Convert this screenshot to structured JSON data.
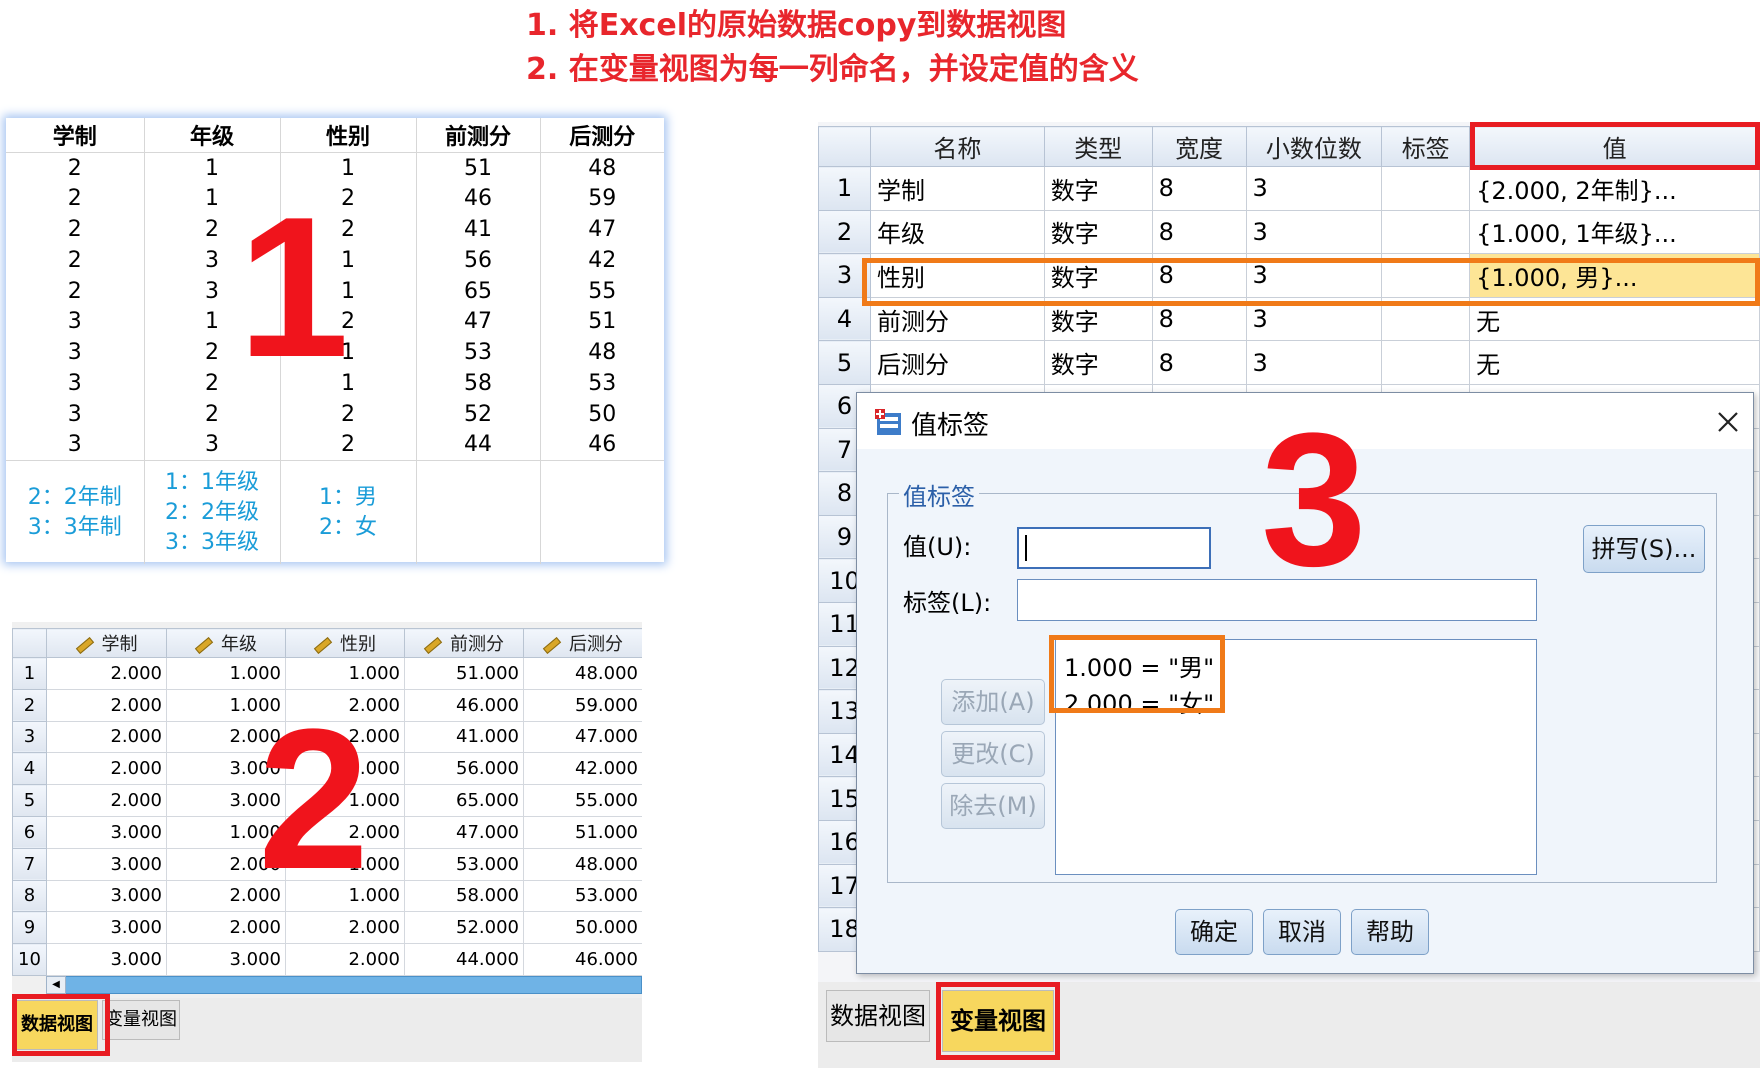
{
  "heading": {
    "line1": "1. 将Excel的原始数据copy到数据视图",
    "line2": "2. 在变量视图为每一列命名，并设定值的含义"
  },
  "panel1": {
    "big_number": "1",
    "headers": [
      "学制",
      "年级",
      "性别",
      "前测分",
      "后测分"
    ],
    "rows": [
      [
        "2",
        "1",
        "1",
        "51",
        "48"
      ],
      [
        "2",
        "1",
        "2",
        "46",
        "59"
      ],
      [
        "2",
        "2",
        "2",
        "41",
        "47"
      ],
      [
        "2",
        "3",
        "1",
        "56",
        "42"
      ],
      [
        "2",
        "3",
        "1",
        "65",
        "55"
      ],
      [
        "3",
        "1",
        "2",
        "47",
        "51"
      ],
      [
        "3",
        "2",
        "1",
        "53",
        "48"
      ],
      [
        "3",
        "2",
        "1",
        "58",
        "53"
      ],
      [
        "3",
        "2",
        "2",
        "52",
        "50"
      ],
      [
        "3",
        "3",
        "2",
        "44",
        "46"
      ]
    ],
    "legend": {
      "xuezhi": [
        "2：2年制",
        "3：3年制"
      ],
      "nianji": [
        "1：1年级",
        "2：2年级",
        "3：3年级"
      ],
      "xingbie": [
        "1：男",
        "2：女"
      ]
    }
  },
  "panel2": {
    "big_number": "2",
    "headers": [
      "学制",
      "年级",
      "性别",
      "前测分",
      "后测分"
    ],
    "rows": [
      [
        "1",
        "2.000",
        "1.000",
        "1.000",
        "51.000",
        "48.000"
      ],
      [
        "2",
        "2.000",
        "1.000",
        "2.000",
        "46.000",
        "59.000"
      ],
      [
        "3",
        "2.000",
        "2.000",
        "2.000",
        "41.000",
        "47.000"
      ],
      [
        "4",
        "2.000",
        "3.000",
        "1.000",
        "56.000",
        "42.000"
      ],
      [
        "5",
        "2.000",
        "3.000",
        "1.000",
        "65.000",
        "55.000"
      ],
      [
        "6",
        "3.000",
        "1.000",
        "2.000",
        "47.000",
        "51.000"
      ],
      [
        "7",
        "3.000",
        "2.000",
        "1.000",
        "53.000",
        "48.000"
      ],
      [
        "8",
        "3.000",
        "2.000",
        "1.000",
        "58.000",
        "53.000"
      ],
      [
        "9",
        "3.000",
        "2.000",
        "2.000",
        "52.000",
        "50.000"
      ],
      [
        "10",
        "3.000",
        "3.000",
        "2.000",
        "44.000",
        "46.000"
      ]
    ],
    "tab_data_view": "数据视图",
    "tab_var_view": "变量视图"
  },
  "panel3": {
    "headers": [
      "名称",
      "类型",
      "宽度",
      "小数位数",
      "标签",
      "值"
    ],
    "rows": [
      [
        "1",
        "学制",
        "数字",
        "8",
        "3",
        "",
        "{2.000, 2年制}..."
      ],
      [
        "2",
        "年级",
        "数字",
        "8",
        "3",
        "",
        "{1.000, 1年级}..."
      ],
      [
        "3",
        "性别",
        "数字",
        "8",
        "3",
        "",
        "{1.000, 男}..."
      ],
      [
        "4",
        "前测分",
        "数字",
        "8",
        "3",
        "",
        "无"
      ],
      [
        "5",
        "后测分",
        "数字",
        "8",
        "3",
        "",
        "无"
      ]
    ],
    "extra_row_numbers": [
      "6",
      "7",
      "8",
      "9",
      "10",
      "11",
      "12",
      "13",
      "14",
      "15",
      "16",
      "17",
      "18"
    ],
    "tab_data_view": "数据视图",
    "tab_var_view": "变量视图"
  },
  "dialog": {
    "title": "值标签",
    "group_label": "值标签",
    "value_label": "值(U):",
    "label_label": "标签(L):",
    "spell_button": "拼写(S)...",
    "add_button": "添加(A)",
    "change_button": "更改(C)",
    "remove_button": "除去(M)",
    "list_items": [
      "1.000 = \"男\"",
      "2.000 = \"女\""
    ],
    "ok_button": "确定",
    "cancel_button": "取消",
    "help_button": "帮助",
    "big_number": "3"
  },
  "colors": {
    "heading_red": "#e8262c",
    "big_number_red": "#f0141c",
    "legend_blue": "#1a9cd8",
    "orange_highlight": "#f07a18",
    "red_highlight": "#e81c22",
    "selected_cell": "#fde596"
  }
}
